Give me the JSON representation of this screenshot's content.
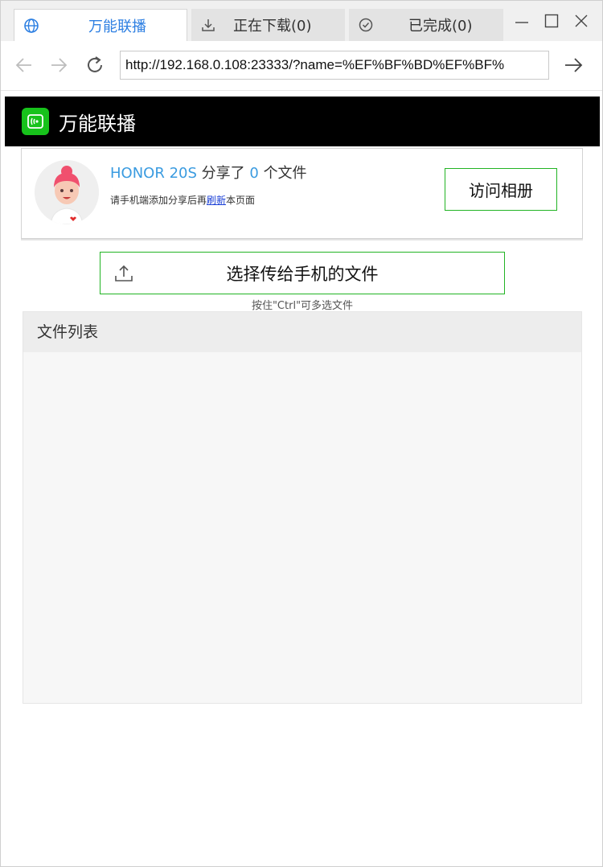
{
  "browser": {
    "tabs": [
      {
        "label": "万能联播",
        "icon": "globe-icon"
      },
      {
        "label": "正在下载(0)",
        "icon": "download-icon"
      },
      {
        "label": "已完成(0)",
        "icon": "check-circle-icon"
      }
    ],
    "url": "http://192.168.0.108:23333/?name=%EF%BF%BD%EF%BF%"
  },
  "app": {
    "title": "万能联播",
    "accent": "#22b424",
    "link_color": "#3a9be0"
  },
  "share": {
    "device": "HONOR 20S",
    "shared_text": "分享了",
    "count": "0",
    "files_text": "个文件",
    "hint_prefix": "请手机端添加分享后再",
    "hint_link": "刷新",
    "hint_suffix": "本页面",
    "album_button": "访问相册"
  },
  "upload": {
    "button_label": "选择传给手机的文件",
    "hint": "按住\"Ctrl\"可多选文件"
  },
  "file_list": {
    "title": "文件列表",
    "items": []
  }
}
